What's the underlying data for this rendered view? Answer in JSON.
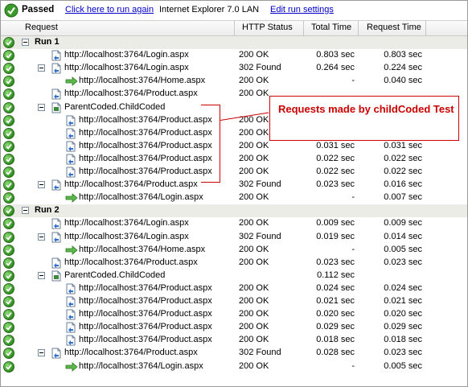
{
  "topbar": {
    "status": "Passed",
    "run_again": "Click here to run again",
    "browser_info": "Internet Explorer 7.0  LAN",
    "edit_settings": "Edit run settings"
  },
  "columns": {
    "request": "Request",
    "http_status": "HTTP Status",
    "total_time": "Total Time",
    "request_time": "Request Time"
  },
  "callout": {
    "text": "Requests made by childCoded Test"
  },
  "rows": [
    {
      "kind": "run",
      "label": "Run 1"
    },
    {
      "kind": "req",
      "level": 1,
      "icon": "doc",
      "url": "http://localhost:3764/Login.aspx",
      "status": "200 OK",
      "total": "0.803 sec",
      "req": "0.803 sec"
    },
    {
      "kind": "req",
      "level": 1,
      "icon": "doc",
      "expander": true,
      "url": "http://localhost:3764/Login.aspx",
      "status": "302 Found",
      "total": "0.264 sec",
      "req": "0.224 sec"
    },
    {
      "kind": "req",
      "level": 2,
      "icon": "arrow",
      "url": "http://localhost:3764/Home.aspx",
      "status": "200 OK",
      "total": "-",
      "req": "0.040 sec"
    },
    {
      "kind": "req",
      "level": 1,
      "icon": "doc",
      "url": "http://localhost:3764/Product.aspx",
      "status": "200 OK",
      "total": "",
      "req": ""
    },
    {
      "kind": "req",
      "level": 1,
      "icon": "coded",
      "expander": true,
      "url": "ParentCoded.ChildCoded",
      "status": "",
      "total": "",
      "req": ""
    },
    {
      "kind": "req",
      "level": 2,
      "icon": "doc",
      "url": "http://localhost:3764/Product.aspx",
      "status": "200 OK",
      "total": "",
      "req": ""
    },
    {
      "kind": "req",
      "level": 2,
      "icon": "doc",
      "url": "http://localhost:3764/Product.aspx",
      "status": "200 OK",
      "total": "",
      "req": ""
    },
    {
      "kind": "req",
      "level": 2,
      "icon": "doc",
      "url": "http://localhost:3764/Product.aspx",
      "status": "200 OK",
      "total": "0.031 sec",
      "req": "0.031 sec"
    },
    {
      "kind": "req",
      "level": 2,
      "icon": "doc",
      "url": "http://localhost:3764/Product.aspx",
      "status": "200 OK",
      "total": "0.022 sec",
      "req": "0.022 sec"
    },
    {
      "kind": "req",
      "level": 2,
      "icon": "doc",
      "url": "http://localhost:3764/Product.aspx",
      "status": "200 OK",
      "total": "0.022 sec",
      "req": "0.022 sec"
    },
    {
      "kind": "req",
      "level": 1,
      "icon": "doc",
      "expander": true,
      "url": "http://localhost:3764/Product.aspx",
      "status": "302 Found",
      "total": "0.023 sec",
      "req": "0.016 sec"
    },
    {
      "kind": "req",
      "level": 2,
      "icon": "arrow",
      "url": "http://localhost:3764/Login.aspx",
      "status": "200 OK",
      "total": "-",
      "req": "0.007 sec"
    },
    {
      "kind": "run",
      "label": "Run 2"
    },
    {
      "kind": "req",
      "level": 1,
      "icon": "doc",
      "url": "http://localhost:3764/Login.aspx",
      "status": "200 OK",
      "total": "0.009 sec",
      "req": "0.009 sec"
    },
    {
      "kind": "req",
      "level": 1,
      "icon": "doc",
      "expander": true,
      "url": "http://localhost:3764/Login.aspx",
      "status": "302 Found",
      "total": "0.019 sec",
      "req": "0.014 sec"
    },
    {
      "kind": "req",
      "level": 2,
      "icon": "arrow",
      "url": "http://localhost:3764/Home.aspx",
      "status": "200 OK",
      "total": "-",
      "req": "0.005 sec"
    },
    {
      "kind": "req",
      "level": 1,
      "icon": "doc",
      "url": "http://localhost:3764/Product.aspx",
      "status": "200 OK",
      "total": "0.023 sec",
      "req": "0.023 sec"
    },
    {
      "kind": "req",
      "level": 1,
      "icon": "coded",
      "expander": true,
      "url": "ParentCoded.ChildCoded",
      "status": "",
      "total": "0.112 sec",
      "req": ""
    },
    {
      "kind": "req",
      "level": 2,
      "icon": "doc",
      "url": "http://localhost:3764/Product.aspx",
      "status": "200 OK",
      "total": "0.024 sec",
      "req": "0.024 sec"
    },
    {
      "kind": "req",
      "level": 2,
      "icon": "doc",
      "url": "http://localhost:3764/Product.aspx",
      "status": "200 OK",
      "total": "0.021 sec",
      "req": "0.021 sec"
    },
    {
      "kind": "req",
      "level": 2,
      "icon": "doc",
      "url": "http://localhost:3764/Product.aspx",
      "status": "200 OK",
      "total": "0.020 sec",
      "req": "0.020 sec"
    },
    {
      "kind": "req",
      "level": 2,
      "icon": "doc",
      "url": "http://localhost:3764/Product.aspx",
      "status": "200 OK",
      "total": "0.029 sec",
      "req": "0.029 sec"
    },
    {
      "kind": "req",
      "level": 2,
      "icon": "doc",
      "url": "http://localhost:3764/Product.aspx",
      "status": "200 OK",
      "total": "0.018 sec",
      "req": "0.018 sec"
    },
    {
      "kind": "req",
      "level": 1,
      "icon": "doc",
      "expander": true,
      "url": "http://localhost:3764/Product.aspx",
      "status": "302 Found",
      "total": "0.028 sec",
      "req": "0.023 sec"
    },
    {
      "kind": "req",
      "level": 2,
      "icon": "arrow",
      "url": "http://localhost:3764/Login.aspx",
      "status": "200 OK",
      "total": "-",
      "req": "0.005 sec"
    }
  ]
}
